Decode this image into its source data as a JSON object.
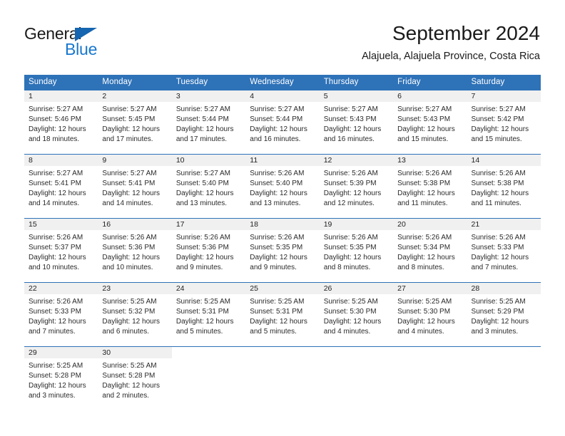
{
  "brand": {
    "name_part1": "General",
    "name_part2": "Blue",
    "triangle_color": "#1565b0",
    "blue_text_color": "#1877cf"
  },
  "header": {
    "title": "September 2024",
    "subtitle": "Alajuela, Alajuela Province, Costa Rica"
  },
  "theme": {
    "header_blue": "#2e72b8",
    "day_band_gray": "#f0f0f0",
    "text_color": "#222222"
  },
  "weekdays": [
    "Sunday",
    "Monday",
    "Tuesday",
    "Wednesday",
    "Thursday",
    "Friday",
    "Saturday"
  ],
  "weeks": [
    [
      {
        "day": "1",
        "sunrise": "Sunrise: 5:27 AM",
        "sunset": "Sunset: 5:46 PM",
        "daylight": "Daylight: 12 hours and 18 minutes."
      },
      {
        "day": "2",
        "sunrise": "Sunrise: 5:27 AM",
        "sunset": "Sunset: 5:45 PM",
        "daylight": "Daylight: 12 hours and 17 minutes."
      },
      {
        "day": "3",
        "sunrise": "Sunrise: 5:27 AM",
        "sunset": "Sunset: 5:44 PM",
        "daylight": "Daylight: 12 hours and 17 minutes."
      },
      {
        "day": "4",
        "sunrise": "Sunrise: 5:27 AM",
        "sunset": "Sunset: 5:44 PM",
        "daylight": "Daylight: 12 hours and 16 minutes."
      },
      {
        "day": "5",
        "sunrise": "Sunrise: 5:27 AM",
        "sunset": "Sunset: 5:43 PM",
        "daylight": "Daylight: 12 hours and 16 minutes."
      },
      {
        "day": "6",
        "sunrise": "Sunrise: 5:27 AM",
        "sunset": "Sunset: 5:43 PM",
        "daylight": "Daylight: 12 hours and 15 minutes."
      },
      {
        "day": "7",
        "sunrise": "Sunrise: 5:27 AM",
        "sunset": "Sunset: 5:42 PM",
        "daylight": "Daylight: 12 hours and 15 minutes."
      }
    ],
    [
      {
        "day": "8",
        "sunrise": "Sunrise: 5:27 AM",
        "sunset": "Sunset: 5:41 PM",
        "daylight": "Daylight: 12 hours and 14 minutes."
      },
      {
        "day": "9",
        "sunrise": "Sunrise: 5:27 AM",
        "sunset": "Sunset: 5:41 PM",
        "daylight": "Daylight: 12 hours and 14 minutes."
      },
      {
        "day": "10",
        "sunrise": "Sunrise: 5:27 AM",
        "sunset": "Sunset: 5:40 PM",
        "daylight": "Daylight: 12 hours and 13 minutes."
      },
      {
        "day": "11",
        "sunrise": "Sunrise: 5:26 AM",
        "sunset": "Sunset: 5:40 PM",
        "daylight": "Daylight: 12 hours and 13 minutes."
      },
      {
        "day": "12",
        "sunrise": "Sunrise: 5:26 AM",
        "sunset": "Sunset: 5:39 PM",
        "daylight": "Daylight: 12 hours and 12 minutes."
      },
      {
        "day": "13",
        "sunrise": "Sunrise: 5:26 AM",
        "sunset": "Sunset: 5:38 PM",
        "daylight": "Daylight: 12 hours and 11 minutes."
      },
      {
        "day": "14",
        "sunrise": "Sunrise: 5:26 AM",
        "sunset": "Sunset: 5:38 PM",
        "daylight": "Daylight: 12 hours and 11 minutes."
      }
    ],
    [
      {
        "day": "15",
        "sunrise": "Sunrise: 5:26 AM",
        "sunset": "Sunset: 5:37 PM",
        "daylight": "Daylight: 12 hours and 10 minutes."
      },
      {
        "day": "16",
        "sunrise": "Sunrise: 5:26 AM",
        "sunset": "Sunset: 5:36 PM",
        "daylight": "Daylight: 12 hours and 10 minutes."
      },
      {
        "day": "17",
        "sunrise": "Sunrise: 5:26 AM",
        "sunset": "Sunset: 5:36 PM",
        "daylight": "Daylight: 12 hours and 9 minutes."
      },
      {
        "day": "18",
        "sunrise": "Sunrise: 5:26 AM",
        "sunset": "Sunset: 5:35 PM",
        "daylight": "Daylight: 12 hours and 9 minutes."
      },
      {
        "day": "19",
        "sunrise": "Sunrise: 5:26 AM",
        "sunset": "Sunset: 5:35 PM",
        "daylight": "Daylight: 12 hours and 8 minutes."
      },
      {
        "day": "20",
        "sunrise": "Sunrise: 5:26 AM",
        "sunset": "Sunset: 5:34 PM",
        "daylight": "Daylight: 12 hours and 8 minutes."
      },
      {
        "day": "21",
        "sunrise": "Sunrise: 5:26 AM",
        "sunset": "Sunset: 5:33 PM",
        "daylight": "Daylight: 12 hours and 7 minutes."
      }
    ],
    [
      {
        "day": "22",
        "sunrise": "Sunrise: 5:26 AM",
        "sunset": "Sunset: 5:33 PM",
        "daylight": "Daylight: 12 hours and 7 minutes."
      },
      {
        "day": "23",
        "sunrise": "Sunrise: 5:25 AM",
        "sunset": "Sunset: 5:32 PM",
        "daylight": "Daylight: 12 hours and 6 minutes."
      },
      {
        "day": "24",
        "sunrise": "Sunrise: 5:25 AM",
        "sunset": "Sunset: 5:31 PM",
        "daylight": "Daylight: 12 hours and 5 minutes."
      },
      {
        "day": "25",
        "sunrise": "Sunrise: 5:25 AM",
        "sunset": "Sunset: 5:31 PM",
        "daylight": "Daylight: 12 hours and 5 minutes."
      },
      {
        "day": "26",
        "sunrise": "Sunrise: 5:25 AM",
        "sunset": "Sunset: 5:30 PM",
        "daylight": "Daylight: 12 hours and 4 minutes."
      },
      {
        "day": "27",
        "sunrise": "Sunrise: 5:25 AM",
        "sunset": "Sunset: 5:30 PM",
        "daylight": "Daylight: 12 hours and 4 minutes."
      },
      {
        "day": "28",
        "sunrise": "Sunrise: 5:25 AM",
        "sunset": "Sunset: 5:29 PM",
        "daylight": "Daylight: 12 hours and 3 minutes."
      }
    ],
    [
      {
        "day": "29",
        "sunrise": "Sunrise: 5:25 AM",
        "sunset": "Sunset: 5:28 PM",
        "daylight": "Daylight: 12 hours and 3 minutes."
      },
      {
        "day": "30",
        "sunrise": "Sunrise: 5:25 AM",
        "sunset": "Sunset: 5:28 PM",
        "daylight": "Daylight: 12 hours and 2 minutes."
      },
      {
        "day": "",
        "sunrise": "",
        "sunset": "",
        "daylight": ""
      },
      {
        "day": "",
        "sunrise": "",
        "sunset": "",
        "daylight": ""
      },
      {
        "day": "",
        "sunrise": "",
        "sunset": "",
        "daylight": ""
      },
      {
        "day": "",
        "sunrise": "",
        "sunset": "",
        "daylight": ""
      },
      {
        "day": "",
        "sunrise": "",
        "sunset": "",
        "daylight": ""
      }
    ]
  ]
}
